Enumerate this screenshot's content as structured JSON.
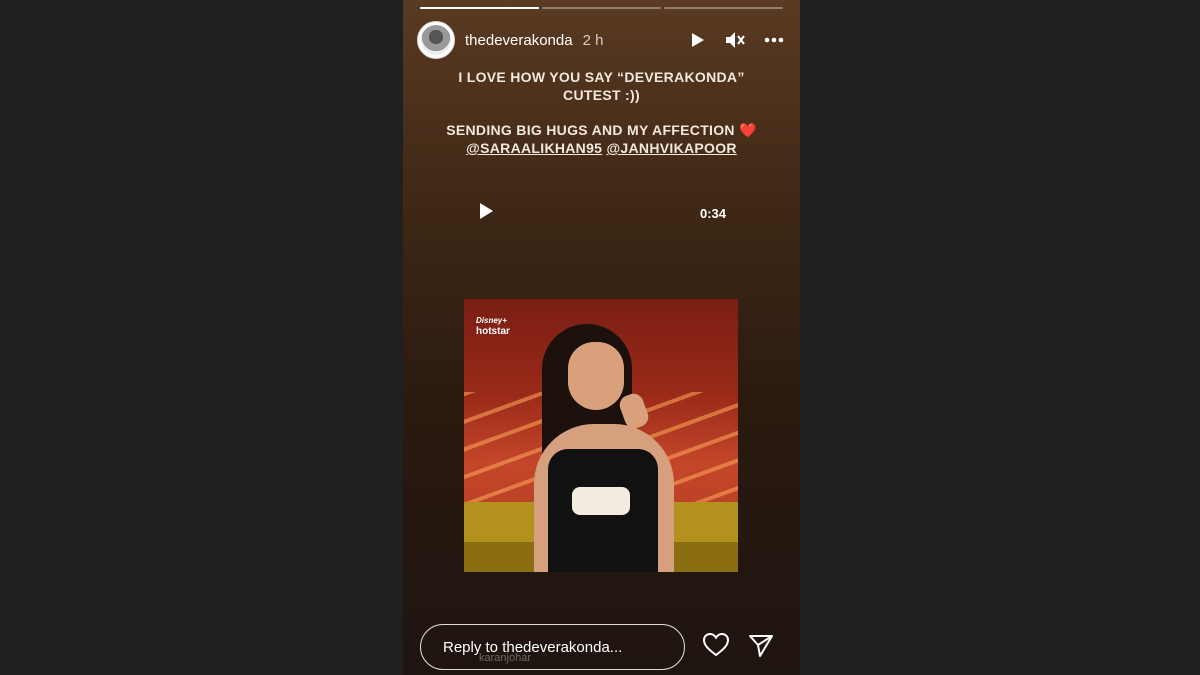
{
  "story": {
    "progress": [
      {
        "filled": 1.0
      },
      {
        "filled": 0
      },
      {
        "filled": 0
      }
    ],
    "header": {
      "username": "thedeverakonda",
      "time": "2 h",
      "icons": [
        "play-icon",
        "mute-icon",
        "more-icon"
      ]
    },
    "caption": {
      "line1": "I LOVE HOW YOU SAY “DEVERAKONDA”",
      "line2": "CUTEST :))",
      "line3": "SENDING BIG HUGS AND MY AFFECTION ❤️",
      "mention1": "@SARAALIKHAN95",
      "mention2": "@JANHVIKAPOOR"
    },
    "video": {
      "duration": "0:34",
      "logo_top": "Disney+",
      "logo_bottom": "hotstar"
    },
    "footer": {
      "reply_placeholder": "Reply to thedeverakonda...",
      "watermark": "karanjohar",
      "icons": [
        "heart-icon",
        "send-icon"
      ]
    },
    "colors": {
      "page_bg": "#202020",
      "story_top": "#5a3a22",
      "story_bottom": "#1e1410",
      "text": "#ffffff"
    }
  }
}
